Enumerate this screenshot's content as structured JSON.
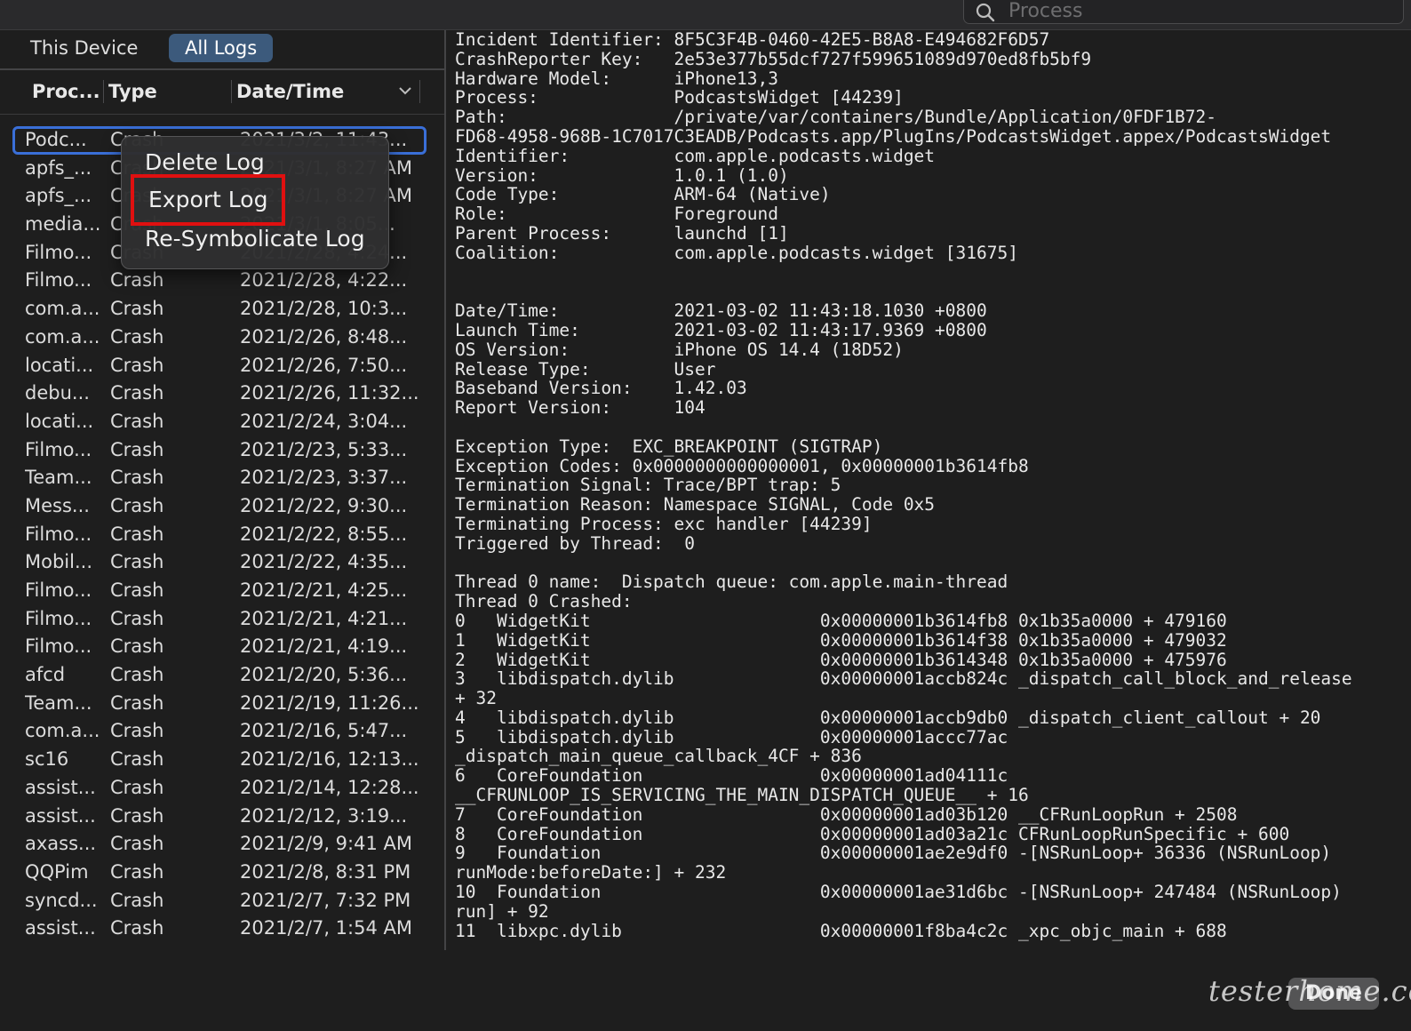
{
  "search": {
    "placeholder": "Process"
  },
  "segments": {
    "this_device": "This Device",
    "all_logs": "All Logs"
  },
  "columns": {
    "process": "Proc...",
    "type": "Type",
    "date": "Date/Time"
  },
  "rows": [
    {
      "process": "Podc...",
      "type": "Crash",
      "date": "2021/3/2, 11:43..."
    },
    {
      "process": "apfs_...",
      "type": "Crash",
      "date": "2021/3/1, 8:27 AM"
    },
    {
      "process": "apfs_...",
      "type": "Crash",
      "date": "2021/3/1, 8:27 AM"
    },
    {
      "process": "media...",
      "type": "Crash",
      "date": "2021/3/1, 8:05..."
    },
    {
      "process": "Filmo...",
      "type": "Crash",
      "date": "2021/2/28, 4:24..."
    },
    {
      "process": "Filmo...",
      "type": "Crash",
      "date": "2021/2/28, 4:22..."
    },
    {
      "process": "com.a...",
      "type": "Crash",
      "date": "2021/2/28, 10:3..."
    },
    {
      "process": "com.a...",
      "type": "Crash",
      "date": "2021/2/26, 8:48..."
    },
    {
      "process": "locati...",
      "type": "Crash",
      "date": "2021/2/26, 7:50..."
    },
    {
      "process": "debu...",
      "type": "Crash",
      "date": "2021/2/26, 11:32..."
    },
    {
      "process": "locati...",
      "type": "Crash",
      "date": "2021/2/24, 3:04..."
    },
    {
      "process": "Filmo...",
      "type": "Crash",
      "date": "2021/2/23, 5:33..."
    },
    {
      "process": "Team...",
      "type": "Crash",
      "date": "2021/2/23, 3:37..."
    },
    {
      "process": "Mess...",
      "type": "Crash",
      "date": "2021/2/22, 9:30..."
    },
    {
      "process": "Filmo...",
      "type": "Crash",
      "date": "2021/2/22, 8:55..."
    },
    {
      "process": "Mobil...",
      "type": "Crash",
      "date": "2021/2/22, 4:35..."
    },
    {
      "process": "Filmo...",
      "type": "Crash",
      "date": "2021/2/21, 4:25..."
    },
    {
      "process": "Filmo...",
      "type": "Crash",
      "date": "2021/2/21, 4:21..."
    },
    {
      "process": "Filmo...",
      "type": "Crash",
      "date": "2021/2/21, 4:19..."
    },
    {
      "process": "afcd",
      "type": "Crash",
      "date": "2021/2/20, 5:36..."
    },
    {
      "process": "Team...",
      "type": "Crash",
      "date": "2021/2/19, 11:26..."
    },
    {
      "process": "com.a...",
      "type": "Crash",
      "date": "2021/2/16, 5:47..."
    },
    {
      "process": "sc16",
      "type": "Crash",
      "date": "2021/2/16, 12:13..."
    },
    {
      "process": "assist...",
      "type": "Crash",
      "date": "2021/2/14, 12:28..."
    },
    {
      "process": "assist...",
      "type": "Crash",
      "date": "2021/2/12, 3:19..."
    },
    {
      "process": "axass...",
      "type": "Crash",
      "date": "2021/2/9, 9:41 AM"
    },
    {
      "process": "QQPim",
      "type": "Crash",
      "date": "2021/2/8, 8:31 PM"
    },
    {
      "process": "syncd...",
      "type": "Crash",
      "date": "2021/2/7, 7:32 PM"
    },
    {
      "process": "assist...",
      "type": "Crash",
      "date": "2021/2/7, 1:54 AM"
    }
  ],
  "context_menu": {
    "delete": "Delete Log",
    "export": "Export Log",
    "resymbolicate": "Re-Symbolicate Log"
  },
  "log_text": "Incident Identifier: 8F5C3F4B-0460-42E5-B8A8-E494682F6D57\nCrashReporter Key:   2e53e377b55dcf727f599651089d970ed8fb5bf9\nHardware Model:      iPhone13,3\nProcess:             PodcastsWidget [44239]\nPath:                /private/var/containers/Bundle/Application/0FDF1B72-\nFD68-4958-968B-1C7017C3EADB/Podcasts.app/PlugIns/PodcastsWidget.appex/PodcastsWidget\nIdentifier:          com.apple.podcasts.widget\nVersion:             1.0.1 (1.0)\nCode Type:           ARM-64 (Native)\nRole:                Foreground\nParent Process:      launchd [1]\nCoalition:           com.apple.podcasts.widget [31675]\n\n\nDate/Time:           2021-03-02 11:43:18.1030 +0800\nLaunch Time:         2021-03-02 11:43:17.9369 +0800\nOS Version:          iPhone OS 14.4 (18D52)\nRelease Type:        User\nBaseband Version:    1.42.03\nReport Version:      104\n\nException Type:  EXC_BREAKPOINT (SIGTRAP)\nException Codes: 0x0000000000000001, 0x00000001b3614fb8\nTermination Signal: Trace/BPT trap: 5\nTermination Reason: Namespace SIGNAL, Code 0x5\nTerminating Process: exc handler [44239]\nTriggered by Thread:  0\n\nThread 0 name:  Dispatch queue: com.apple.main-thread\nThread 0 Crashed:\n0   WidgetKit                      0x00000001b3614fb8 0x1b35a0000 + 479160\n1   WidgetKit                      0x00000001b3614f38 0x1b35a0000 + 479032\n2   WidgetKit                      0x00000001b3614348 0x1b35a0000 + 475976\n3   libdispatch.dylib              0x00000001accb824c _dispatch_call_block_and_release\n+ 32\n4   libdispatch.dylib              0x00000001accb9db0 _dispatch_client_callout + 20\n5   libdispatch.dylib              0x00000001accc77ac\n_dispatch_main_queue_callback_4CF + 836\n6   CoreFoundation                 0x00000001ad04111c\n__CFRUNLOOP_IS_SERVICING_THE_MAIN_DISPATCH_QUEUE__ + 16\n7   CoreFoundation                 0x00000001ad03b120 __CFRunLoopRun + 2508\n8   CoreFoundation                 0x00000001ad03a21c CFRunLoopRunSpecific + 600\n9   Foundation                     0x00000001ae2e9df0 -[NSRunLoop+ 36336 (NSRunLoop)\nrunMode:beforeDate:] + 232\n10  Foundation                     0x00000001ae31d6bc -[NSRunLoop+ 247484 (NSRunLoop)\nrun] + 92\n11  libxpc.dylib                   0x00000001f8ba4c2c _xpc_objc_main + 688",
  "footer": {
    "done": "Done",
    "watermark": "testerhome.com"
  },
  "colors": {
    "accent": "#3a6fd8",
    "highlight_box": "#e01010",
    "segment_active": "#3c5a7c"
  },
  "icons": {
    "search": "search-icon",
    "sort": "chevron-down-icon"
  }
}
